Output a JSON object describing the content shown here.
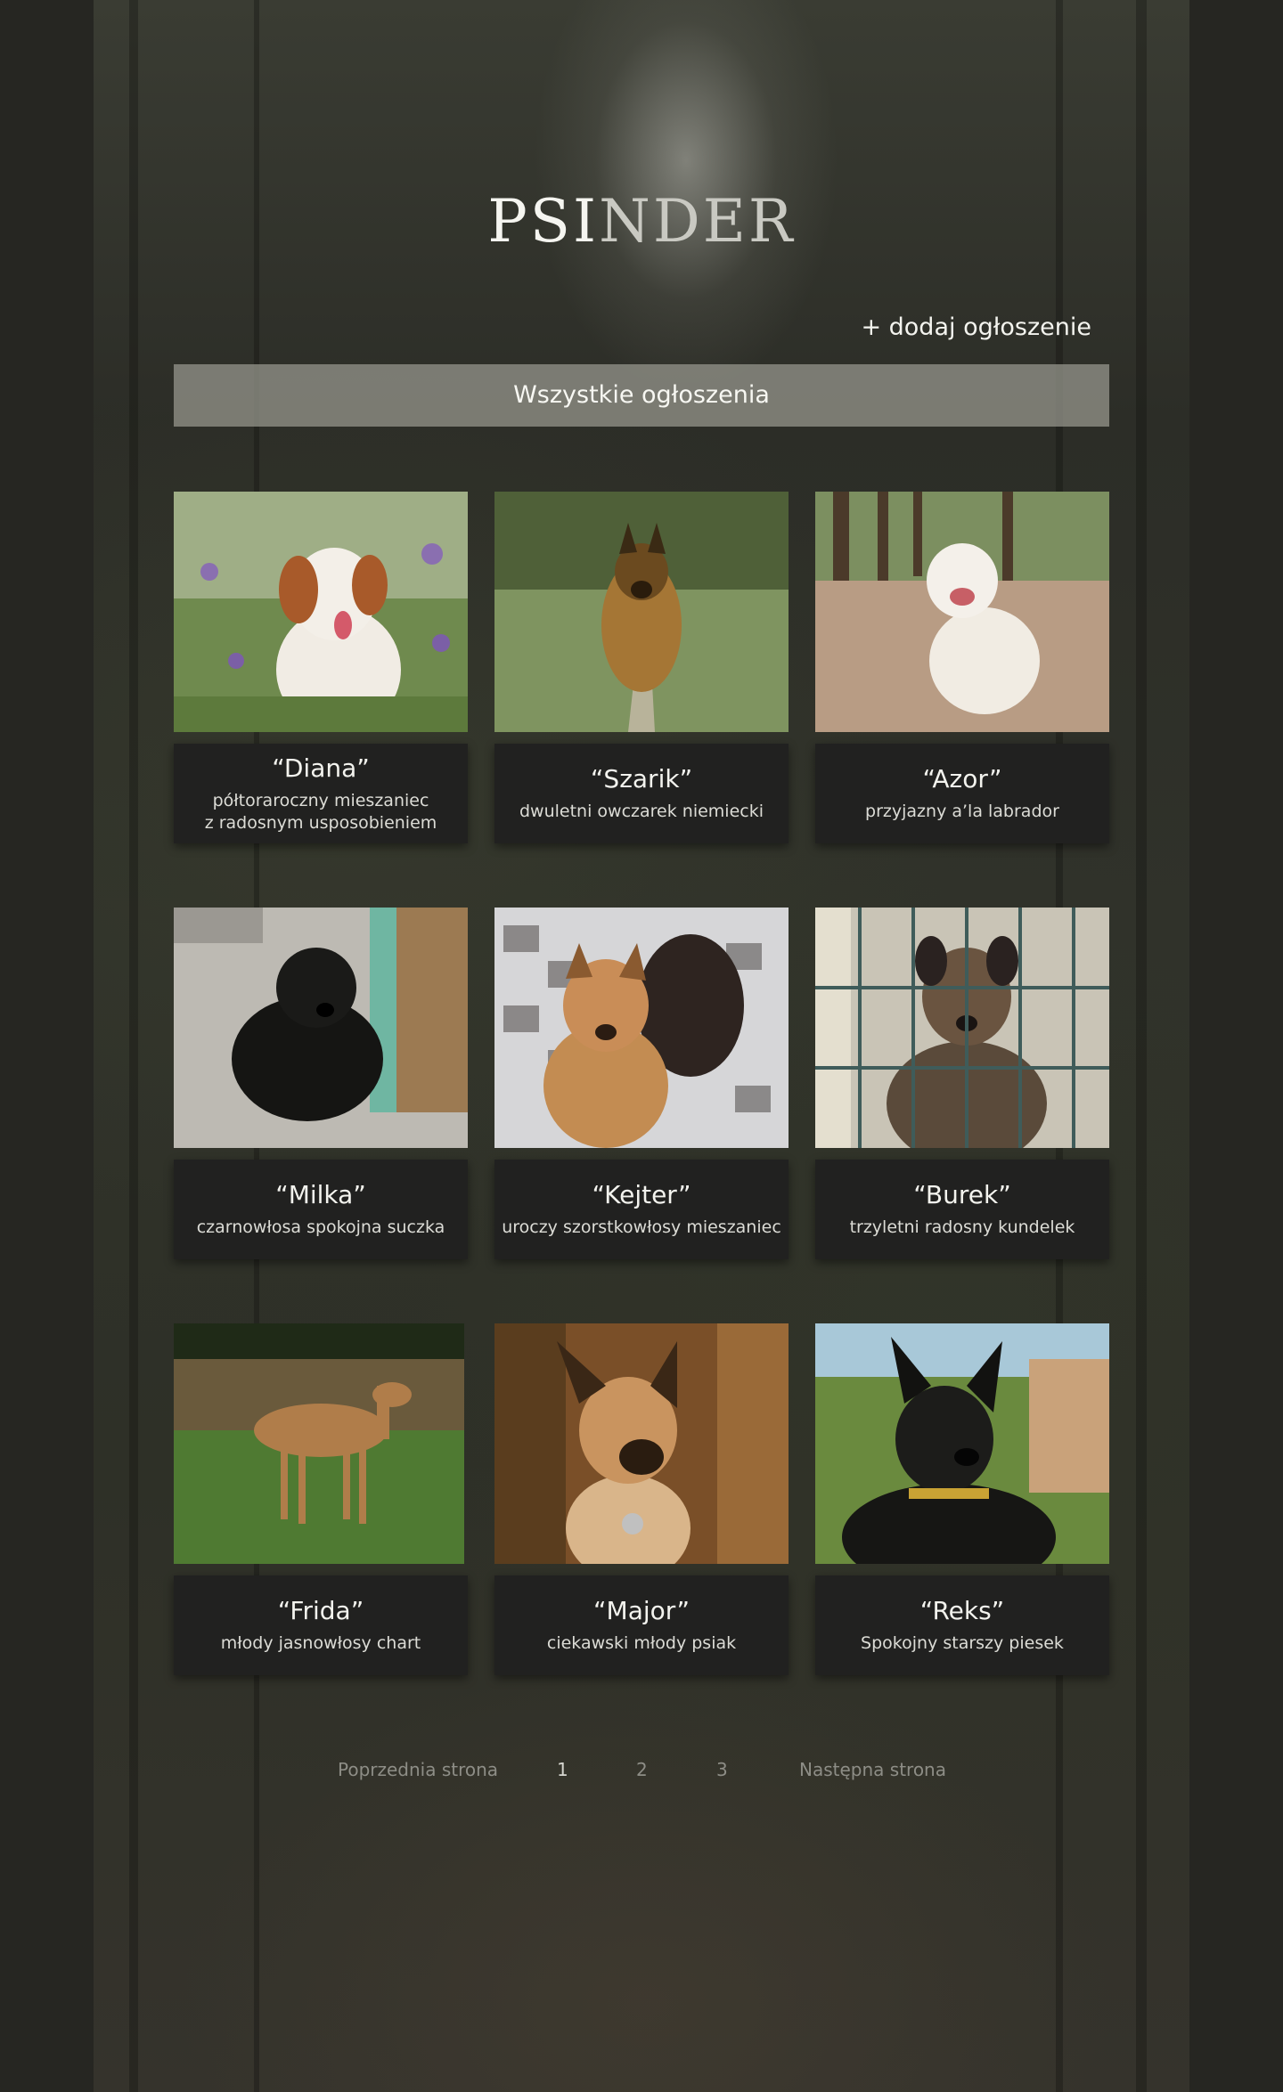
{
  "brand": {
    "part1": "PSI",
    "part2": "NDER"
  },
  "header": {
    "add_link": "+ dodaj ogłoszenie"
  },
  "filter": {
    "label": "Wszystkie ogłoszenia"
  },
  "listings": [
    {
      "name": "“Diana”",
      "desc": "półtoraroczny mieszaniec\nz radosnym usposobieniem"
    },
    {
      "name": "“Szarik”",
      "desc": "dwuletni owczarek niemiecki"
    },
    {
      "name": "“Azor”",
      "desc": "przyjazny a’la labrador"
    },
    {
      "name": "“Milka”",
      "desc": "czarnowłosa spokojna suczka"
    },
    {
      "name": "“Kejter”",
      "desc": "uroczy szorstkowłosy mieszaniec"
    },
    {
      "name": "“Burek”",
      "desc": "trzyletni radosny kundelek"
    },
    {
      "name": "“Frida”",
      "desc": "młody jasnowłosy chart"
    },
    {
      "name": "“Major”",
      "desc": "ciekawski młody psiak"
    },
    {
      "name": "“Reks”",
      "desc": "Spokojny starszy piesek"
    }
  ],
  "pagination": {
    "prev": "Poprzednia strona",
    "pages": [
      "1",
      "2",
      "3"
    ],
    "current": "1",
    "next": "Następna strona"
  },
  "colors": {
    "card_background": "#212120",
    "filter_bar": "#96968c",
    "page_background": "#262622"
  }
}
